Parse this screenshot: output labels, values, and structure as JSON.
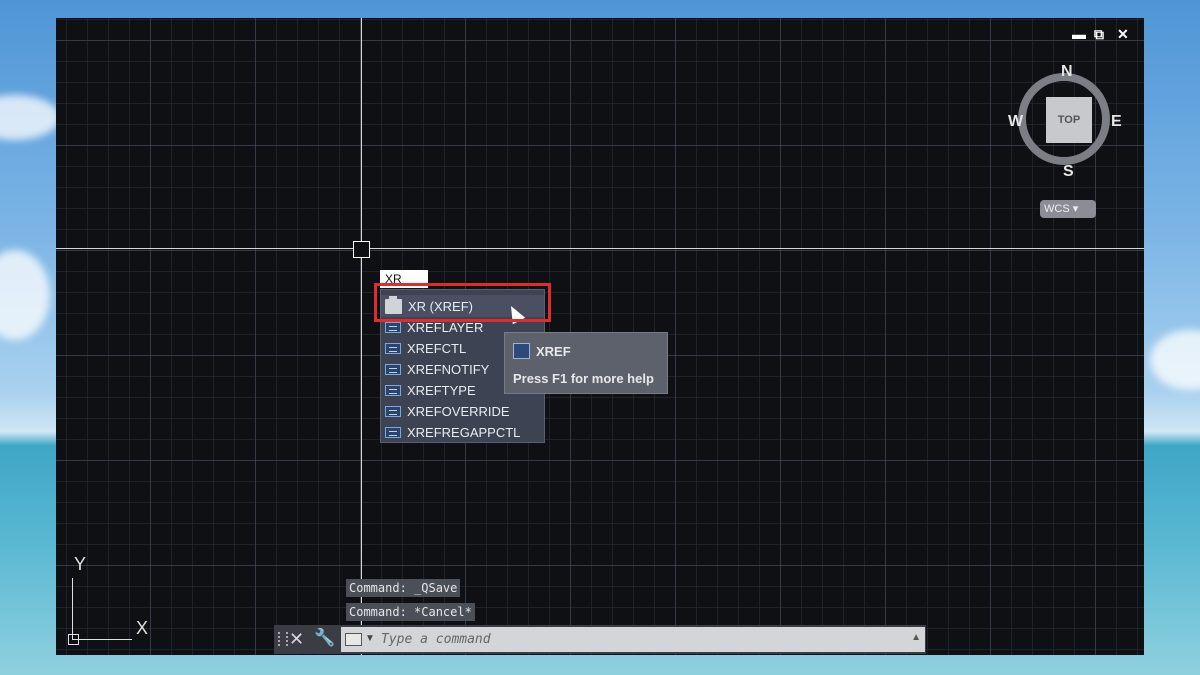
{
  "window": {
    "controls": {
      "minimize": "▬",
      "restore": "⧉",
      "close": "✕"
    }
  },
  "dynamic_input": {
    "value": "XR"
  },
  "autocomplete": {
    "items": [
      {
        "label": "XR (XREF)",
        "icon": "command-icon"
      },
      {
        "label": "XREFLAYER",
        "icon": "system-variable-icon"
      },
      {
        "label": "XREFCTL",
        "icon": "system-variable-icon"
      },
      {
        "label": "XREFNOTIFY",
        "icon": "system-variable-icon"
      },
      {
        "label": "XREFTYPE",
        "icon": "system-variable-icon"
      },
      {
        "label": "XREFOVERRIDE",
        "icon": "system-variable-icon"
      },
      {
        "label": "XREFREGAPPCTL",
        "icon": "system-variable-icon"
      }
    ],
    "highlight_color": "#e22b2b"
  },
  "tooltip": {
    "title": "XREF",
    "help": "Press F1 for more help"
  },
  "viewcube": {
    "top": "TOP",
    "n": "N",
    "s": "S",
    "e": "E",
    "w": "W",
    "wcs": "WCS ▾"
  },
  "ucs": {
    "x": "X",
    "y": "Y"
  },
  "command_line": {
    "history": [
      "Command: _QSave",
      "Command: *Cancel*"
    ],
    "placeholder": "Type a command",
    "value": ""
  }
}
